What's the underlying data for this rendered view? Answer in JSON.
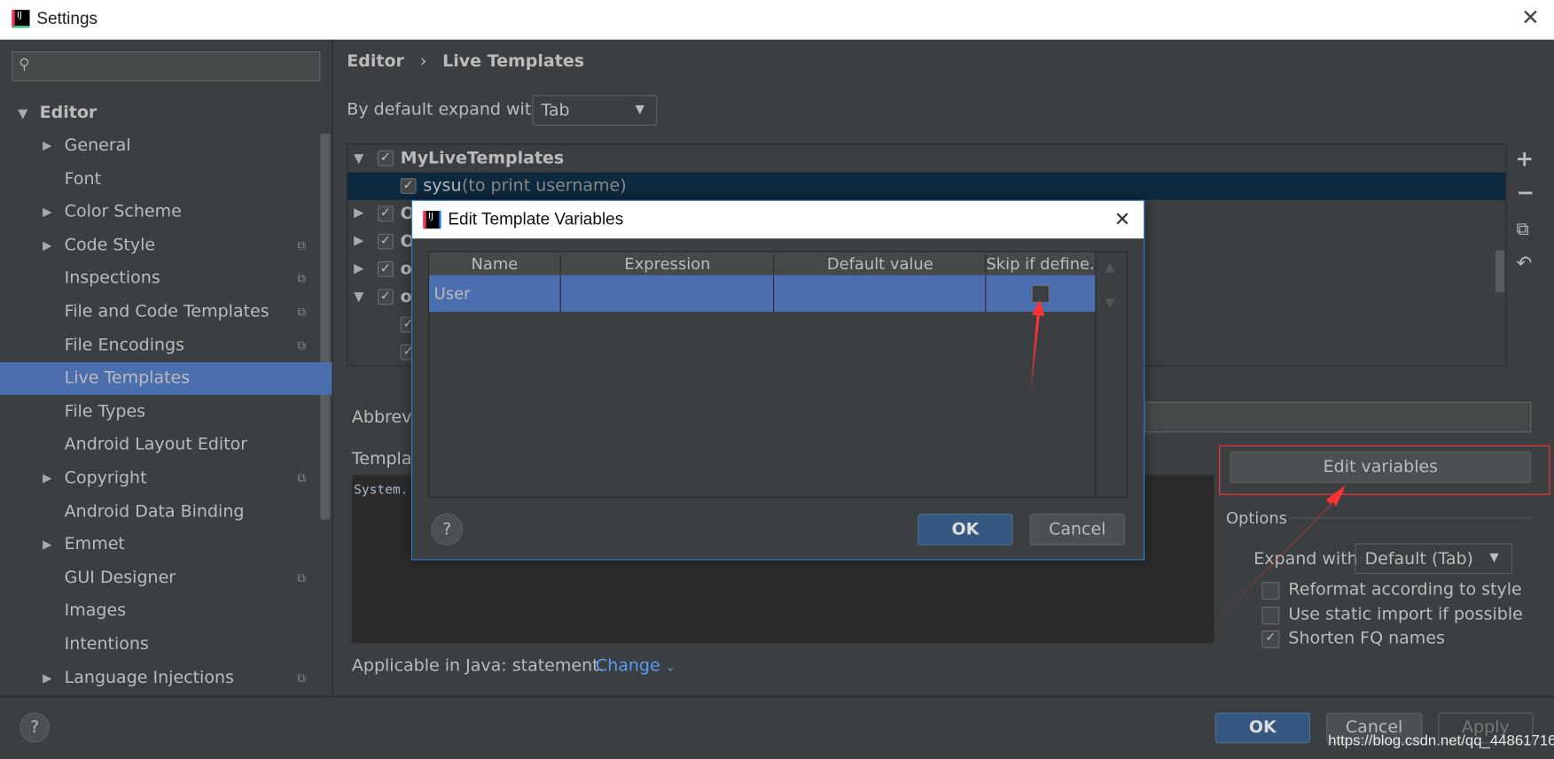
{
  "window": {
    "title": "Settings",
    "close_icon": "close-icon"
  },
  "sidebar": {
    "search_placeholder": "",
    "root": "Editor",
    "items": [
      {
        "label": "General",
        "expandable": true,
        "copy": false
      },
      {
        "label": "Font",
        "expandable": false,
        "copy": false
      },
      {
        "label": "Color Scheme",
        "expandable": true,
        "copy": false
      },
      {
        "label": "Code Style",
        "expandable": true,
        "copy": true
      },
      {
        "label": "Inspections",
        "expandable": false,
        "copy": true
      },
      {
        "label": "File and Code Templates",
        "expandable": false,
        "copy": true
      },
      {
        "label": "File Encodings",
        "expandable": false,
        "copy": true
      },
      {
        "label": "Live Templates",
        "expandable": false,
        "copy": false,
        "selected": true
      },
      {
        "label": "File Types",
        "expandable": false,
        "copy": false
      },
      {
        "label": "Android Layout Editor",
        "expandable": false,
        "copy": false
      },
      {
        "label": "Copyright",
        "expandable": true,
        "copy": true
      },
      {
        "label": "Android Data Binding",
        "expandable": false,
        "copy": false
      },
      {
        "label": "Emmet",
        "expandable": true,
        "copy": false
      },
      {
        "label": "GUI Designer",
        "expandable": false,
        "copy": true
      },
      {
        "label": "Images",
        "expandable": false,
        "copy": false
      },
      {
        "label": "Intentions",
        "expandable": false,
        "copy": false
      },
      {
        "label": "Language Injections",
        "expandable": true,
        "copy": true
      }
    ]
  },
  "main": {
    "breadcrumb": [
      "Editor",
      "Live Templates"
    ],
    "expand_label": "By default expand with",
    "expand_value": "Tab",
    "tree": {
      "group": "MyLiveTemplates",
      "selected_item": {
        "abbr": "sysu",
        "desc": "(to print username)"
      },
      "partial_rows": [
        "O",
        "O",
        "o",
        "o"
      ]
    },
    "abbreviation_label": "Abbrevi",
    "template_text_label": "Templa",
    "template_text": "System.",
    "edit_variables": "Edit variables",
    "options_label": "Options",
    "expand_with_label": "Expand with",
    "expand_with_value": "Default (Tab)",
    "options": [
      {
        "label": "Reformat according to style",
        "checked": false
      },
      {
        "label": "Use static import if possible",
        "checked": false
      },
      {
        "label": "Shorten FQ names",
        "checked": true
      }
    ],
    "applicable": "Applicable in Java: statement.",
    "change": "Change"
  },
  "footer": {
    "ok": "OK",
    "cancel": "Cancel",
    "apply": "Apply",
    "watermark": "https://blog.csdn.net/qq_44861716"
  },
  "dialog": {
    "title": "Edit Template Variables",
    "columns": [
      "Name",
      "Expression",
      "Default value",
      "Skip if define..."
    ],
    "rows": [
      {
        "name": "User",
        "expression": "",
        "default": "",
        "skip": false
      }
    ],
    "ok": "OK",
    "cancel": "Cancel",
    "help": "?"
  },
  "colors": {
    "selection": "#4b6eaf",
    "tree_selection": "#0d293e",
    "annotation": "#ff3333",
    "link": "#589df6"
  }
}
